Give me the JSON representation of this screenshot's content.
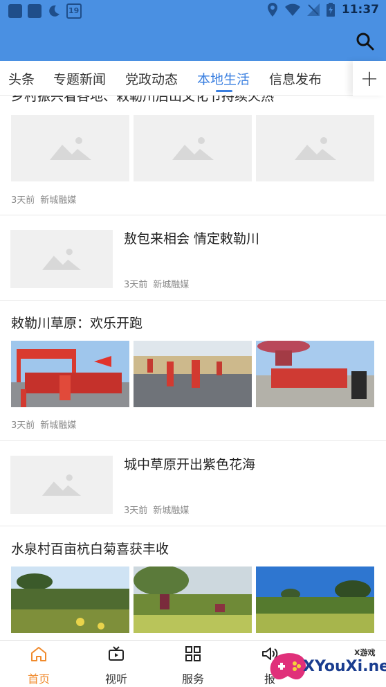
{
  "status_bar": {
    "time": "11:37",
    "calendar_day": "19",
    "icons": [
      "app-icon",
      "app-icon",
      "moon-icon",
      "calendar-icon",
      "location-icon",
      "wifi-icon",
      "no-signal-icon",
      "battery-icon"
    ]
  },
  "app_bar": {
    "color": "#4a90e2",
    "search_icon": "search-icon"
  },
  "tabs": {
    "items": [
      {
        "label": "头条",
        "active": false
      },
      {
        "label": "专题新闻",
        "active": false
      },
      {
        "label": "党政动态",
        "active": false
      },
      {
        "label": "本地生活",
        "active": true
      },
      {
        "label": "信息发布",
        "active": false
      }
    ],
    "add_label": "+",
    "accent": "#3a7fe0"
  },
  "feed": {
    "items": [
      {
        "layout": "three-images",
        "title": "乡村振兴看各地、敕勒川后山文化节持续火热",
        "time": "3天前",
        "source": "新城融媒",
        "images": [
          "placeholder",
          "placeholder",
          "placeholder"
        ]
      },
      {
        "layout": "left-image",
        "title": "敖包来相会  情定敕勒川",
        "time": "3天前",
        "source": "新城融媒"
      },
      {
        "layout": "three-images",
        "title": "敕勒川草原：欢乐开跑",
        "time": "3天前",
        "source": "新城融媒",
        "images": [
          "marathon-start-arch",
          "runners-on-road",
          "group-photo-with-flowers"
        ]
      },
      {
        "layout": "left-image",
        "title": "城中草原开出紫色花海",
        "time": "3天前",
        "source": "新城融媒"
      },
      {
        "layout": "three-images",
        "title": "水泉村百亩杭白菊喜获丰收",
        "images": [
          "chrysanthemum-field",
          "harvest-workers",
          "flower-field-trees"
        ]
      }
    ]
  },
  "bottom_nav": {
    "items": [
      {
        "label": "首页",
        "icon": "home-icon",
        "active": true
      },
      {
        "label": "视听",
        "icon": "video-icon",
        "active": false
      },
      {
        "label": "服务",
        "icon": "grid-icon",
        "active": false
      },
      {
        "label": "报",
        "icon": "speaker-icon",
        "active": false
      }
    ],
    "active_color": "#f08a2c"
  },
  "watermark": {
    "text": "XYouXi.net",
    "small": "X游戏"
  }
}
